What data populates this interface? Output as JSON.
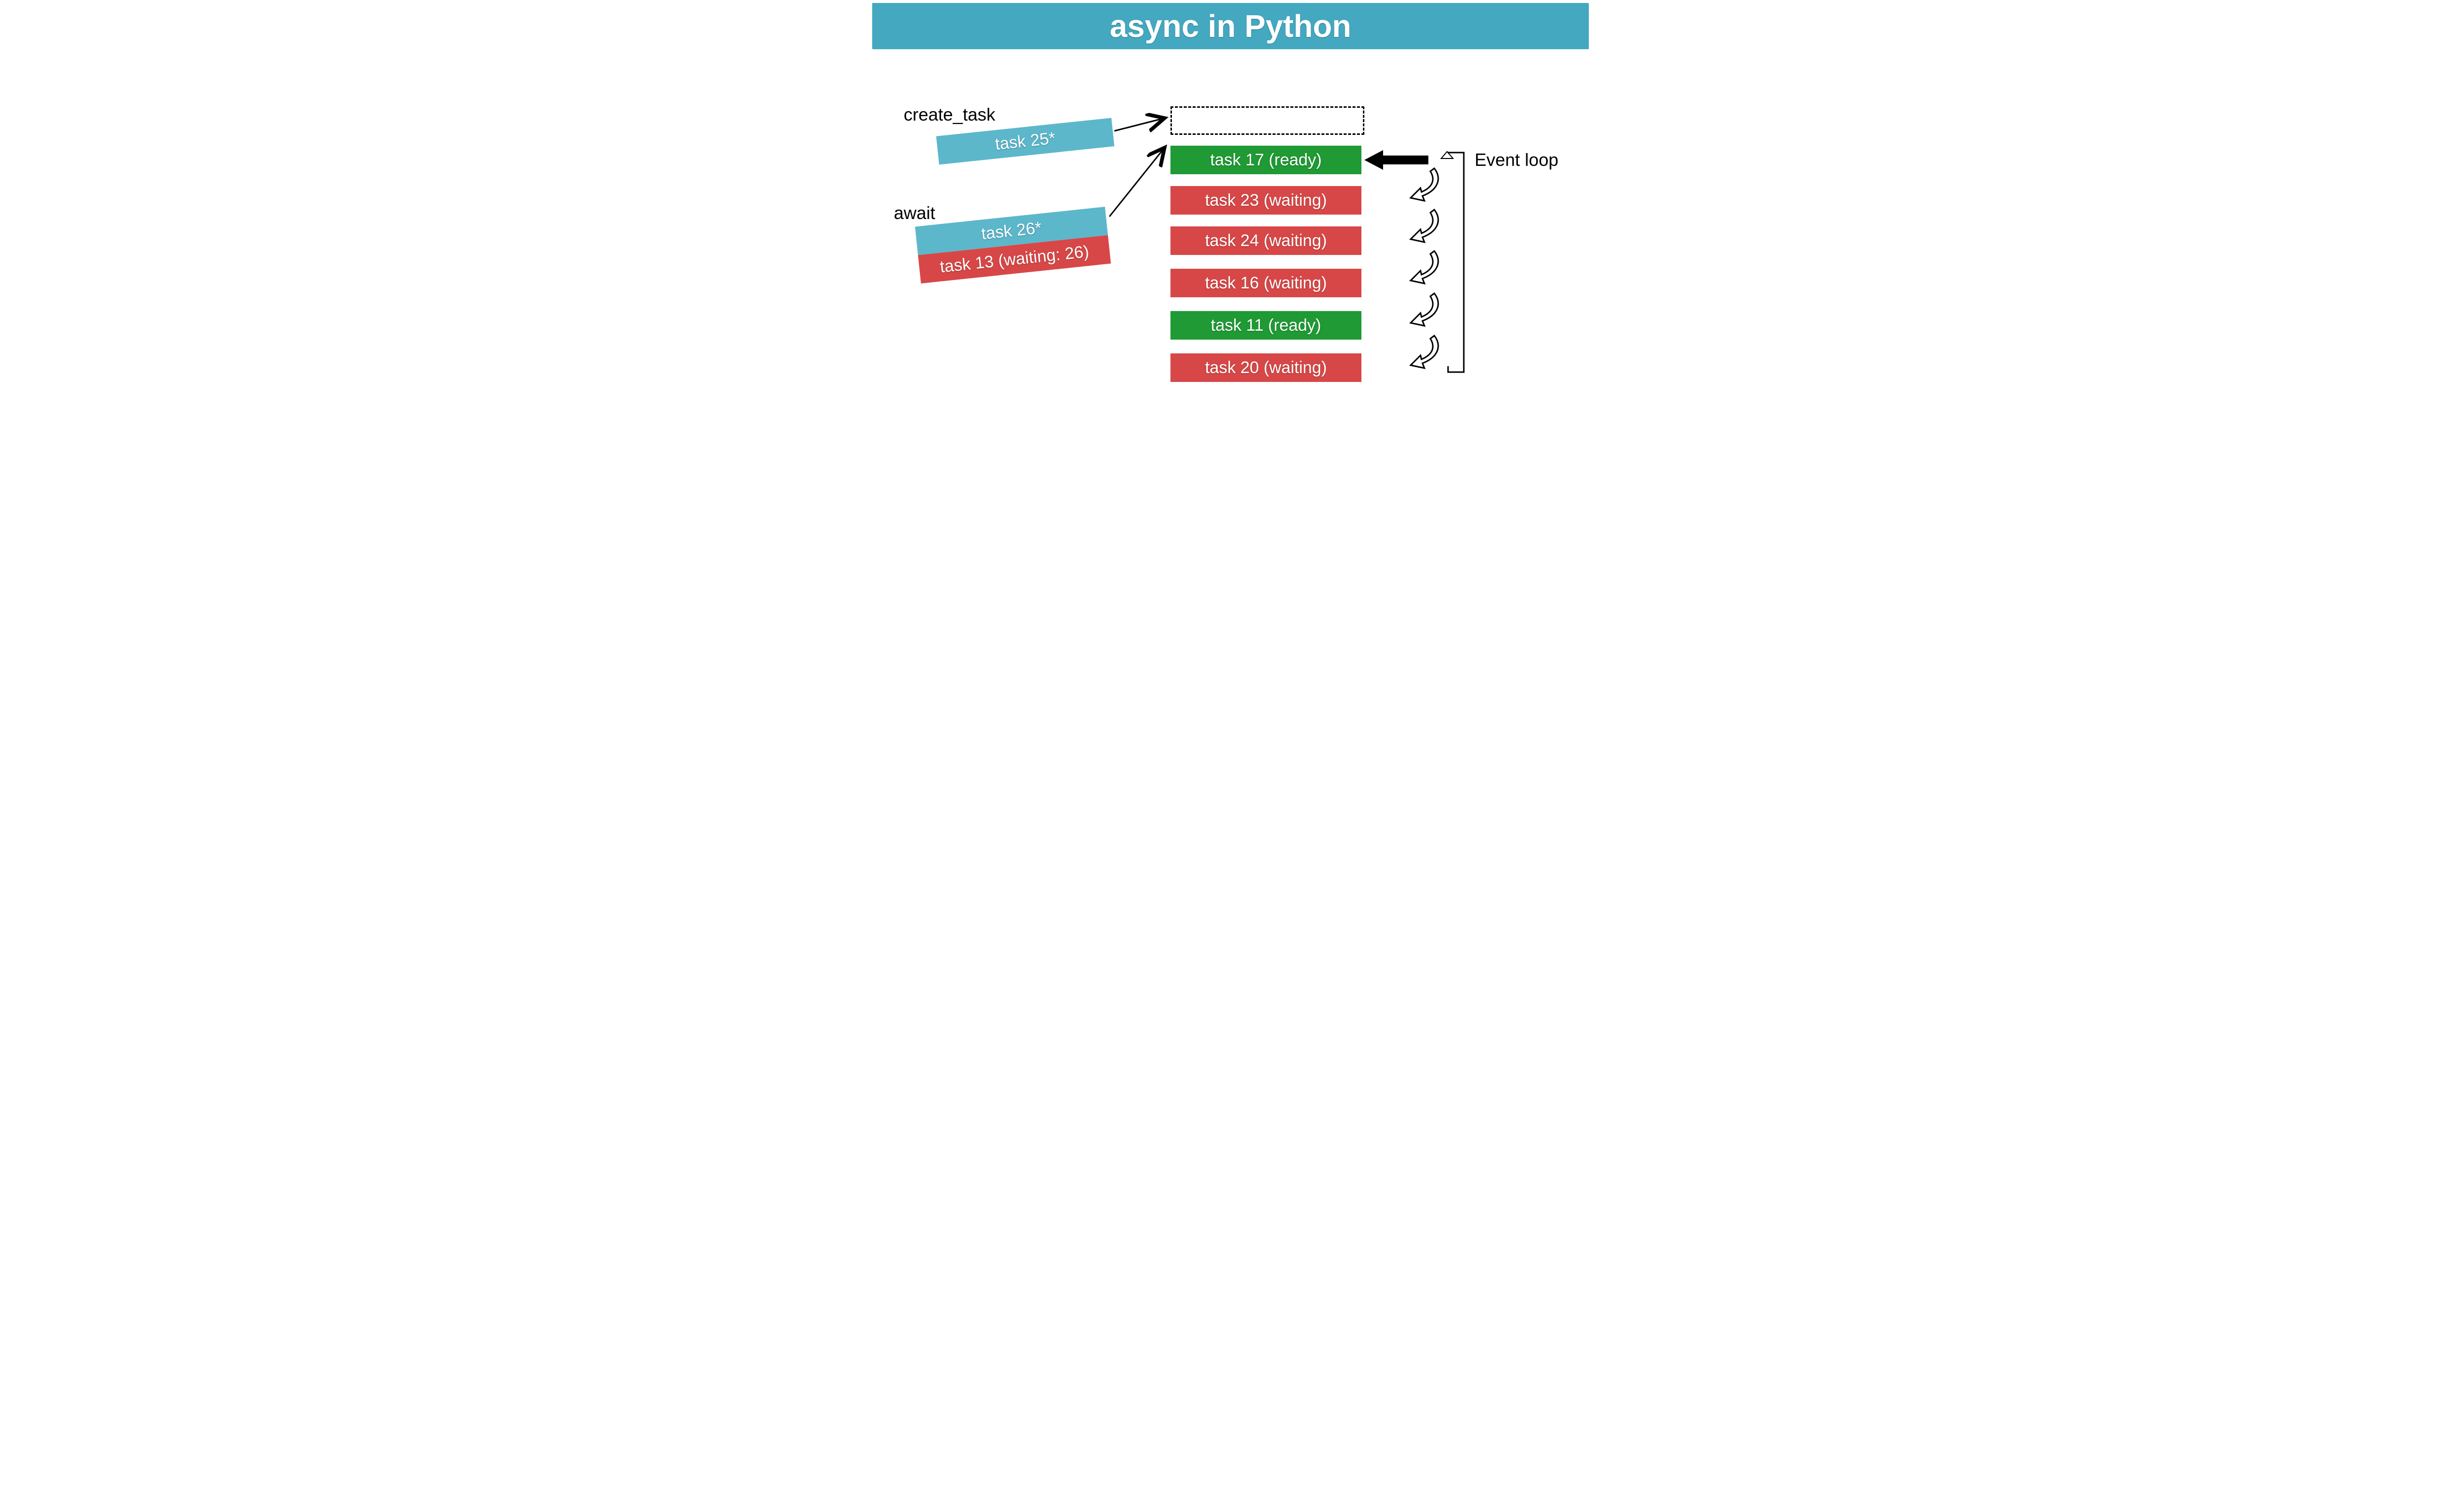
{
  "title": "async in Python",
  "labels": {
    "create_task": "create_task",
    "await": "await",
    "event_loop": "Event loop"
  },
  "incoming": {
    "task25": "task 25*",
    "task26": "task 26*",
    "task13": "task 13 (waiting: 26)"
  },
  "queue": [
    {
      "text": "task 17 (ready)",
      "status": "ready"
    },
    {
      "text": "task 23 (waiting)",
      "status": "waiting"
    },
    {
      "text": "task 24 (waiting)",
      "status": "waiting"
    },
    {
      "text": "task 16 (waiting)",
      "status": "waiting"
    },
    {
      "text": "task 11 (ready)",
      "status": "ready"
    },
    {
      "text": "task 20 (waiting)",
      "status": "waiting"
    }
  ]
}
